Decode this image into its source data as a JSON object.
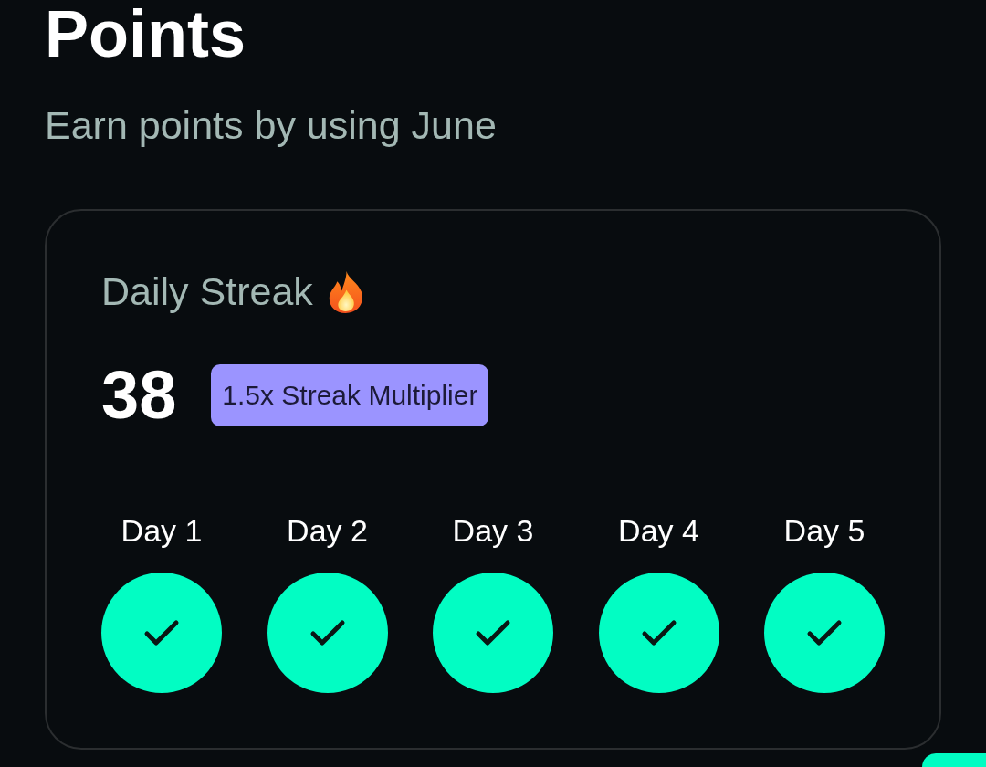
{
  "header": {
    "title": "Points",
    "subtitle": "Earn points by using June"
  },
  "streak_card": {
    "title": "Daily Streak",
    "count": "38",
    "badge": "1.5x Streak Multiplier",
    "days": [
      {
        "label": "Day 1",
        "checked": true
      },
      {
        "label": "Day 2",
        "checked": true
      },
      {
        "label": "Day 3",
        "checked": true
      },
      {
        "label": "Day 4",
        "checked": true
      },
      {
        "label": "Day 5",
        "checked": true
      }
    ]
  }
}
